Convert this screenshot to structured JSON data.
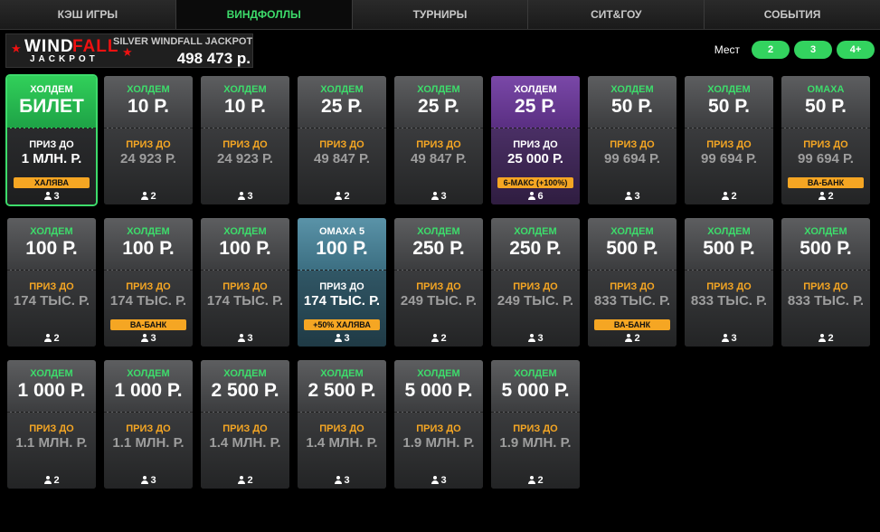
{
  "tabs": [
    {
      "label": "КЭШ ИГРЫ",
      "active": false
    },
    {
      "label": "ВИНДФОЛЛЫ",
      "active": true
    },
    {
      "label": "ТУРНИРЫ",
      "active": false
    },
    {
      "label": "СИТ&ГОУ",
      "active": false
    },
    {
      "label": "СОБЫТИЯ",
      "active": false
    }
  ],
  "jackpot": {
    "logo_wind": "WIND",
    "logo_fall": "FALL",
    "logo_jackpot": "JACKPOT",
    "title": "SILVER WINDFALL JACKPOT",
    "amount": "498 473 р."
  },
  "seats": {
    "label": "Мест",
    "options": [
      "2",
      "3",
      "4+"
    ]
  },
  "colors": {
    "accent_green": "#3ddc6b",
    "prize_orange": "#f5a623",
    "purple": "#5a2f82",
    "teal": "#3c6f82"
  },
  "cards": [
    {
      "game": "ХОЛДЕМ",
      "price": "БИЛЕТ",
      "prize_label": "ПРИЗ ДО",
      "prize": "1 МЛН. Р.",
      "badge": "ХАЛЯВА",
      "players": "3",
      "style": "gold",
      "selected": true
    },
    {
      "game": "ХОЛДЕМ",
      "price": "10 Р.",
      "prize_label": "ПРИЗ ДО",
      "prize": "24 923 Р.",
      "badge": "",
      "players": "2",
      "style": ""
    },
    {
      "game": "ХОЛДЕМ",
      "price": "10 Р.",
      "prize_label": "ПРИЗ ДО",
      "prize": "24 923 Р.",
      "badge": "",
      "players": "3",
      "style": ""
    },
    {
      "game": "ХОЛДЕМ",
      "price": "25 Р.",
      "prize_label": "ПРИЗ ДО",
      "prize": "49 847 Р.",
      "badge": "",
      "players": "2",
      "style": ""
    },
    {
      "game": "ХОЛДЕМ",
      "price": "25 Р.",
      "prize_label": "ПРИЗ ДО",
      "prize": "49 847 Р.",
      "badge": "",
      "players": "3",
      "style": ""
    },
    {
      "game": "ХОЛДЕМ",
      "price": "25 Р.",
      "prize_label": "ПРИЗ ДО",
      "prize": "25 000 Р.",
      "badge": "6-МАКС (+100%)",
      "players": "6",
      "style": "purple"
    },
    {
      "game": "ХОЛДЕМ",
      "price": "50 Р.",
      "prize_label": "ПРИЗ ДО",
      "prize": "99 694 Р.",
      "badge": "",
      "players": "3",
      "style": ""
    },
    {
      "game": "ХОЛДЕМ",
      "price": "50 Р.",
      "prize_label": "ПРИЗ ДО",
      "prize": "99 694 Р.",
      "badge": "",
      "players": "2",
      "style": ""
    },
    {
      "game": "ОМАХА",
      "price": "50 Р.",
      "prize_label": "ПРИЗ ДО",
      "prize": "99 694 Р.",
      "badge": "ВА-БАНК",
      "players": "2",
      "style": ""
    },
    {
      "game": "ХОЛДЕМ",
      "price": "100 Р.",
      "prize_label": "ПРИЗ ДО",
      "prize": "174 ТЫС. Р.",
      "badge": "",
      "players": "2",
      "style": ""
    },
    {
      "game": "ХОЛДЕМ",
      "price": "100 Р.",
      "prize_label": "ПРИЗ ДО",
      "prize": "174 ТЫС. Р.",
      "badge": "ВА-БАНК",
      "players": "3",
      "style": ""
    },
    {
      "game": "ХОЛДЕМ",
      "price": "100 Р.",
      "prize_label": "ПРИЗ ДО",
      "prize": "174 ТЫС. Р.",
      "badge": "",
      "players": "3",
      "style": ""
    },
    {
      "game": "ОМАХА 5",
      "price": "100 Р.",
      "prize_label": "ПРИЗ ДО",
      "prize": "174 ТЫС. Р.",
      "badge": "+50% ХАЛЯВА",
      "players": "3",
      "style": "teal"
    },
    {
      "game": "ХОЛДЕМ",
      "price": "250 Р.",
      "prize_label": "ПРИЗ ДО",
      "prize": "249 ТЫС. Р.",
      "badge": "",
      "players": "2",
      "style": ""
    },
    {
      "game": "ХОЛДЕМ",
      "price": "250 Р.",
      "prize_label": "ПРИЗ ДО",
      "prize": "249 ТЫС. Р.",
      "badge": "",
      "players": "3",
      "style": ""
    },
    {
      "game": "ХОЛДЕМ",
      "price": "500 Р.",
      "prize_label": "ПРИЗ ДО",
      "prize": "833 ТЫС. Р.",
      "badge": "ВА-БАНК",
      "players": "2",
      "style": ""
    },
    {
      "game": "ХОЛДЕМ",
      "price": "500 Р.",
      "prize_label": "ПРИЗ ДО",
      "prize": "833 ТЫС. Р.",
      "badge": "",
      "players": "3",
      "style": ""
    },
    {
      "game": "ХОЛДЕМ",
      "price": "500 Р.",
      "prize_label": "ПРИЗ ДО",
      "prize": "833 ТЫС. Р.",
      "badge": "",
      "players": "2",
      "style": ""
    },
    {
      "game": "ХОЛДЕМ",
      "price": "1 000 Р.",
      "prize_label": "ПРИЗ ДО",
      "prize": "1.1 МЛН. Р.",
      "badge": "",
      "players": "2",
      "style": ""
    },
    {
      "game": "ХОЛДЕМ",
      "price": "1 000 Р.",
      "prize_label": "ПРИЗ ДО",
      "prize": "1.1 МЛН. Р.",
      "badge": "",
      "players": "3",
      "style": ""
    },
    {
      "game": "ХОЛДЕМ",
      "price": "2 500 Р.",
      "prize_label": "ПРИЗ ДО",
      "prize": "1.4 МЛН. Р.",
      "badge": "",
      "players": "2",
      "style": ""
    },
    {
      "game": "ХОЛДЕМ",
      "price": "2 500 Р.",
      "prize_label": "ПРИЗ ДО",
      "prize": "1.4 МЛН. Р.",
      "badge": "",
      "players": "3",
      "style": ""
    },
    {
      "game": "ХОЛДЕМ",
      "price": "5 000 Р.",
      "prize_label": "ПРИЗ ДО",
      "prize": "1.9 МЛН. Р.",
      "badge": "",
      "players": "3",
      "style": ""
    },
    {
      "game": "ХОЛДЕМ",
      "price": "5 000 Р.",
      "prize_label": "ПРИЗ ДО",
      "prize": "1.9 МЛН. Р.",
      "badge": "",
      "players": "2",
      "style": ""
    }
  ]
}
